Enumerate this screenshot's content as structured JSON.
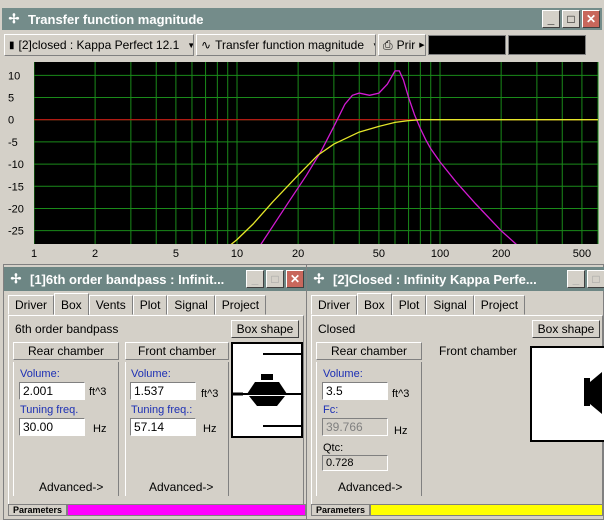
{
  "main_window": {
    "title": "Transfer function magnitude",
    "project_select": "[2]closed : Kappa Perfect 12.1",
    "view_select": "Transfer function magnitude",
    "print_label": "Prir"
  },
  "chart_data": {
    "type": "line",
    "title": "",
    "xlabel": "",
    "ylabel": "",
    "x_scale": "log",
    "xlim": [
      1,
      600
    ],
    "ylim": [
      -28,
      13
    ],
    "x_tick_labels": [
      "1",
      "2",
      "5",
      "10",
      "20",
      "50",
      "100",
      "200",
      "500"
    ],
    "x_ticks": [
      1,
      2,
      5,
      10,
      20,
      50,
      100,
      200,
      500
    ],
    "y_ticks": [
      10,
      5,
      0,
      -5,
      -10,
      -15,
      -20,
      -25
    ],
    "grid": true,
    "background": "#000000",
    "grid_color": "#1a8a1a",
    "reference_line": {
      "y": 0,
      "color": "#c81414"
    },
    "series": [
      {
        "color": "#d21ad2",
        "x": [
          12.3,
          15,
          18,
          22,
          26,
          30,
          34,
          37,
          40,
          45,
          50,
          55,
          60,
          63,
          66,
          70,
          75,
          80,
          85,
          90,
          100,
          120,
          150,
          200,
          250
        ],
        "y": [
          -30,
          -24,
          -18.5,
          -12.5,
          -7,
          -1.5,
          3.5,
          5.5,
          6,
          5.5,
          6,
          8,
          11,
          11,
          9,
          5,
          1,
          -2,
          -4.5,
          -6.5,
          -9.5,
          -14,
          -19,
          -25,
          -29
        ]
      },
      {
        "color": "#e6e62a",
        "x": [
          8.3,
          10,
          12,
          15,
          20,
          25,
          30,
          40,
          50,
          60,
          70,
          80,
          100,
          200,
          500,
          600
        ],
        "y": [
          -30,
          -27,
          -23.5,
          -18.5,
          -12.5,
          -8,
          -5.5,
          -2.8,
          -1.5,
          -0.6,
          -0.2,
          0,
          0,
          0,
          0,
          0
        ]
      }
    ]
  },
  "panel1": {
    "title": "[1]6th order bandpass : Infinit...",
    "tabs": [
      "Driver",
      "Box",
      "Vents",
      "Plot",
      "Signal",
      "Project"
    ],
    "box_type": "6th order bandpass",
    "box_shape_button": "Box shape",
    "rear_chamber_button": "Rear chamber",
    "front_chamber_button": "Front chamber",
    "rear": {
      "volume_label": "Volume:",
      "volume": "2.001",
      "volume_unit": "ft^3",
      "tuning_label": "Tuning freq.",
      "tuning": "30.00",
      "tuning_unit": "Hz"
    },
    "front": {
      "volume_label": "Volume:",
      "volume": "1.537",
      "volume_unit": "ft^3",
      "tuning_label": "Tuning freq.:",
      "tuning": "57.14",
      "tuning_unit": "Hz"
    },
    "advanced_rear": "Advanced->",
    "advanced_front": "Advanced->",
    "status_label": "Parameters",
    "status_color": "#ff00ff"
  },
  "panel2": {
    "title": "[2]Closed : Infinity Kappa Perfe...",
    "tabs": [
      "Driver",
      "Box",
      "Plot",
      "Signal",
      "Project"
    ],
    "box_type": "Closed",
    "box_shape_button": "Box shape",
    "rear_chamber_button": "Rear chamber",
    "front_chamber_button": "Front chamber",
    "volume_label": "Volume:",
    "volume": "3.5",
    "volume_unit": "ft^3",
    "fc_label": "Fc:",
    "fc": "39.766",
    "fc_unit": "Hz",
    "qtc_label": "Qtc:",
    "qtc": "0.728",
    "advanced": "Advanced->",
    "status_label": "Parameters",
    "status_color": "#ffff00"
  }
}
